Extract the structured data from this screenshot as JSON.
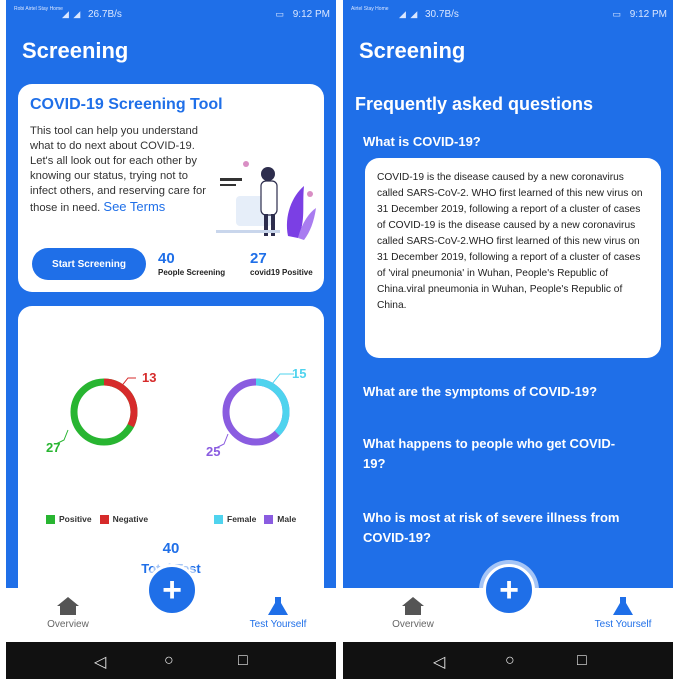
{
  "status_left": {
    "carrier": "Robi\nAirtel Stay Home",
    "speed": "26.7B/s",
    "time": "9:12 PM"
  },
  "status_right": {
    "carrier": "Airtel Stay Home",
    "speed": "30.7B/s",
    "time": "9:12 PM"
  },
  "left": {
    "title": "Screening",
    "tool_card": {
      "title": "COVID-19 Screening Tool",
      "description": "This tool can help you understand what to do next about COVID-19. Let's all look out for each other by knowing our status, trying not to infect others, and reserving care for those in need.",
      "link": "See Terms",
      "start_button": "Start Screening",
      "stat1_num": "40",
      "stat1_label": "People Screening",
      "stat2_num": "27",
      "stat2_label": "covid19 Positive"
    },
    "chart_card": {
      "donut1": {
        "value_a": "13",
        "value_b": "27",
        "color_a": "#d62b2b",
        "color_b": "#28b531",
        "a": 13,
        "b": 27
      },
      "donut2": {
        "value_a": "15",
        "value_b": "25",
        "color_a": "#4fd3ee",
        "color_b": "#8a5ce0",
        "a": 15,
        "b": 25
      },
      "legend1": [
        "Positive",
        "Negative"
      ],
      "legend2": [
        "Female",
        "Male"
      ],
      "total_num": "40",
      "total_label": "Total Test"
    }
  },
  "right": {
    "title": "Screening",
    "faq_heading": "Frequently asked questions",
    "q1": "What is COVID-19?",
    "answer": "COVID-19 is the disease caused by a new coronavirus called SARS-CoV-2. WHO first learned of this new virus on 31 December 2019, following a report of a cluster of cases of COVID-19 is the disease caused by a new coronavirus called SARS-CoV-2.WHO first learned of this new virus on 31 December 2019, following a report of a cluster of cases of 'viral pneumonia' in Wuhan, People's Republic of China.viral pneumonia in Wuhan, People's Republic of China.",
    "q2": "What are the symptoms of COVID-19?",
    "q3": "What happens to people who get COVID-19?",
    "q4": "Who is most at risk of severe illness from COVID-19?"
  },
  "nav": {
    "overview": "Overview",
    "test_yourself": "Test Yourself",
    "fab_symbol": "+"
  },
  "colors": {
    "primary": "#1f6fe8",
    "positive": "#28b531",
    "negative": "#d62b2b",
    "female": "#4fd3ee",
    "male": "#8a5ce0"
  }
}
